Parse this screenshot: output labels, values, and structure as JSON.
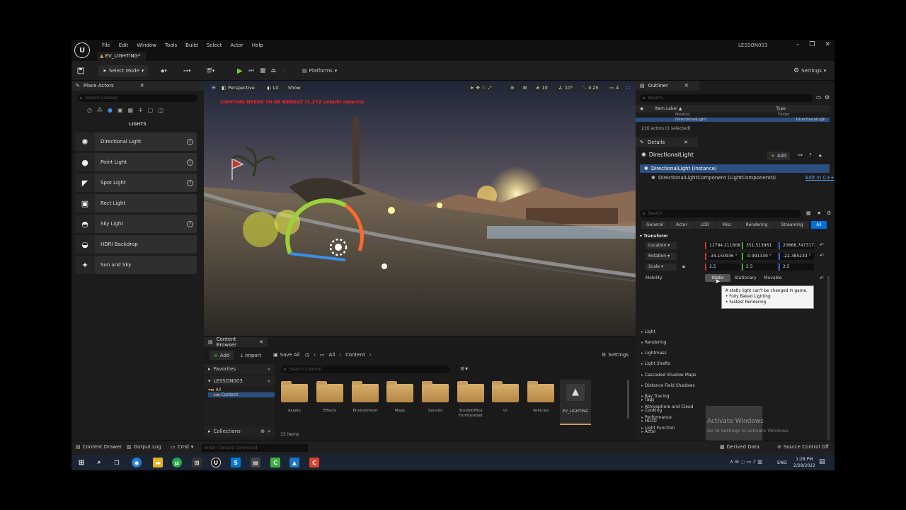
{
  "title_bar": {
    "logo": "U",
    "menu": [
      "File",
      "Edit",
      "Window",
      "Tools",
      "Build",
      "Select",
      "Actor",
      "Help"
    ],
    "level_tab": "EV_LIGHTING*",
    "project_name": "LESSON003",
    "window_controls": [
      "–",
      "❐",
      "✕"
    ]
  },
  "toolbar": {
    "select_mode": "Select Mode",
    "platforms": "Platforms",
    "settings": "Settings"
  },
  "place_actors": {
    "tab_label": "Place Actors",
    "search_placeholder": "Search Classes",
    "section": "LIGHTS",
    "items": [
      {
        "label": "Directional Light",
        "help": true
      },
      {
        "label": "Point Light",
        "help": true
      },
      {
        "label": "Spot Light",
        "help": true
      },
      {
        "label": "Rect Light",
        "help": false
      },
      {
        "label": "Sky Light",
        "help": true
      },
      {
        "label": "HDRI Backdrop",
        "help": false
      },
      {
        "label": "Sun and Sky",
        "help": false
      }
    ]
  },
  "viewport": {
    "perspective": "Perspective",
    "lit": "Lit",
    "show": "Show",
    "warning": "LIGHTING NEEDS TO BE REBUILT (1,272 unbuilt objects)",
    "grid_size": "10",
    "rotation_snap": "10°",
    "scale_snap": "0.25",
    "camera_speed": "4"
  },
  "content_browser": {
    "tab_label": "Content Browser",
    "add": "Add",
    "import": "Import",
    "save_all": "Save All",
    "path": [
      "All",
      "Content"
    ],
    "settings": "Settings",
    "favorites": "Favorites",
    "project": "LESSON003",
    "tree": [
      "All",
      "Content"
    ],
    "search_placeholder": "Search Content",
    "folders": [
      "Assets",
      "Effects",
      "Environment",
      "Maps",
      "Sounds",
      "StudioOffice FurnitureSet",
      "UI",
      "Vehicles"
    ],
    "level_asset": "EV_LIGHTING",
    "collections": "Collections",
    "item_count": "13 items"
  },
  "outliner": {
    "tab_label": "Outliner",
    "search_placeholder": "Search...",
    "col_label": "Item Label ▲",
    "col_type": "Type",
    "rows": [
      {
        "label": "Meshes",
        "type": "Folder"
      },
      {
        "label": "DirectionalLight",
        "type": "DirectionalLigh"
      }
    ],
    "summary": "216 actors (1 selected)"
  },
  "details": {
    "tab_label": "Details",
    "actor_name": "DirectionalLight",
    "add": "Add",
    "instance": "DirectionalLight (Instance)",
    "component": "DirectionalLightComponent (LightComponent0)",
    "edit_cpp": "Edit in C++",
    "search_placeholder": "Search",
    "filters": [
      "General",
      "Actor",
      "LOD",
      "Misc",
      "Rendering",
      "Streaming",
      "All"
    ],
    "transform_header": "Transform",
    "location_label": "Location",
    "rotation_label": "Rotation",
    "scale_label": "Scale",
    "location": [
      "11794.211608",
      "351.513961",
      "20868.747317"
    ],
    "rotation": [
      "-34.150936 °",
      "-0.991339 °",
      "-22.385233 °"
    ],
    "scale": [
      "2.5",
      "2.5",
      "2.5"
    ],
    "mobility_label": "Mobility",
    "mobility_options": [
      "Static",
      "Stationary",
      "Movable"
    ],
    "tooltip": [
      "A static light can't be changed in game.",
      "• Fully Baked Lighting",
      "• Fastest Rendering"
    ],
    "categories": [
      "Light",
      "Rendering",
      "Lightmass",
      "Light Shafts",
      "Cascaded Shadow Maps",
      "Distance Field Shadows",
      "Ray Tracing",
      "Atmosphere and Cloud",
      "Performance",
      "Light Function",
      "Tags",
      "Cooking",
      "HLOD",
      "Actor"
    ]
  },
  "statusbar": {
    "content_drawer": "Content Drawer",
    "output_log": "Output Log",
    "cmd": "Cmd",
    "console_placeholder": "Enter Console Command",
    "derived_data": "Derived Data",
    "source_control": "Source Control Off"
  },
  "watermark": {
    "line1": "Activate Windows",
    "line2": "Go to Settings to activate Windows."
  },
  "taskbar": {
    "lang": "ENG",
    "time": "1:28 PM",
    "date": "2/28/2022"
  },
  "colors": {
    "accent": "#0070e0",
    "selection": "#2b4f80",
    "warning": "#ff2222"
  }
}
